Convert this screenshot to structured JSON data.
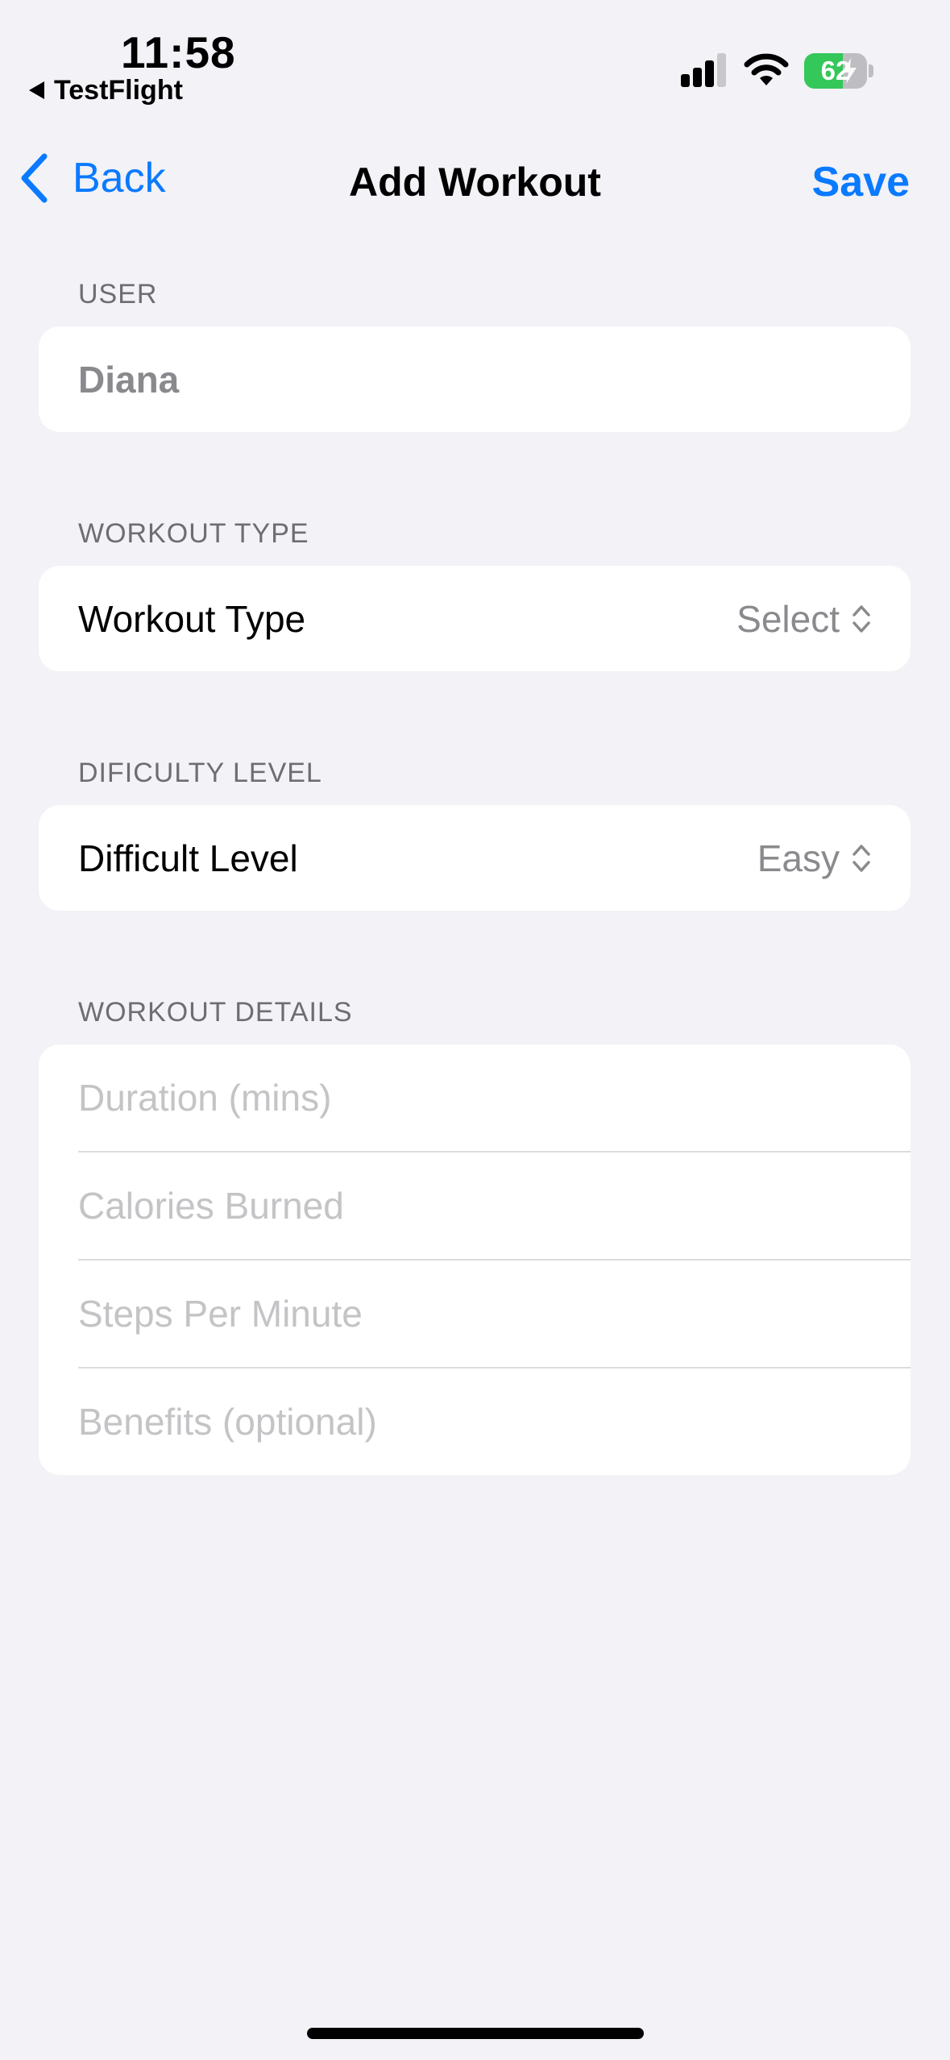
{
  "status_bar": {
    "time": "11:58",
    "back_app_label": "TestFlight",
    "battery_percent": "62",
    "battery_level": 0.62,
    "battery_color": "#34c759"
  },
  "nav": {
    "back_label": "Back",
    "title": "Add Workout",
    "save_label": "Save",
    "accent_color": "#0a7aff"
  },
  "user_section": {
    "header": "USER",
    "value": "Diana"
  },
  "workout_type_section": {
    "header": "WORKOUT TYPE",
    "label": "Workout Type",
    "value": "Select"
  },
  "difficulty_section": {
    "header": "DIFICULTY LEVEL",
    "label": "Difficult Level",
    "value": "Easy"
  },
  "details_section": {
    "header": "WORKOUT DETAILS",
    "fields": [
      {
        "placeholder": "Duration (mins)",
        "value": ""
      },
      {
        "placeholder": "Calories Burned",
        "value": ""
      },
      {
        "placeholder": "Steps Per Minute",
        "value": ""
      },
      {
        "placeholder": "Benefits (optional)",
        "value": ""
      }
    ]
  },
  "icons": {
    "signal": "cellular-signal-icon",
    "wifi": "wifi-icon",
    "battery": "battery-charging-icon",
    "back": "chevron-left-icon",
    "picker": "chevron-up-down-icon"
  }
}
